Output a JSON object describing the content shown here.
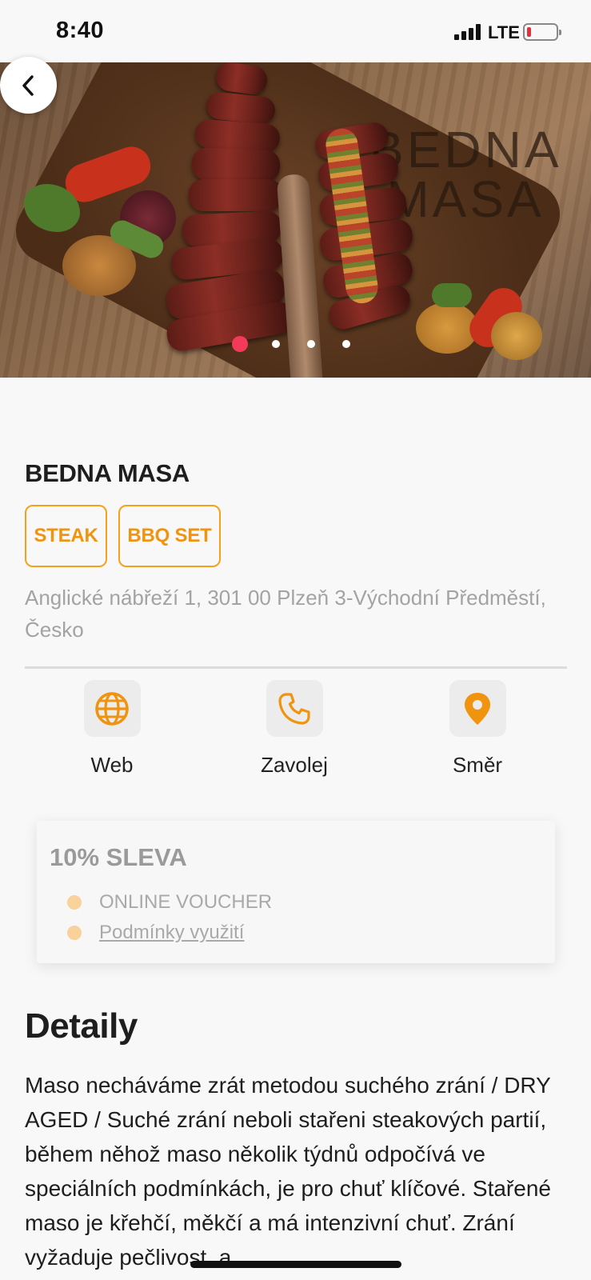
{
  "status_bar": {
    "time": "8:40",
    "network": "LTE",
    "battery_level": 0.1,
    "battery_color": "#e0333f"
  },
  "hero": {
    "logo_line1": "BEDNA",
    "logo_line2": "MASA",
    "image_count": 4,
    "active_image": 1,
    "active_dot_color": "#f33a5a"
  },
  "restaurant": {
    "name": "BEDNA MASA",
    "tags": [
      "STEAK",
      "BBQ SET"
    ],
    "address": "Anglické nábřeží 1, 301 00 Plzeň 3-Východní Předměstí, Česko"
  },
  "actions": {
    "web_label": "Web",
    "call_label": "Zavolej",
    "direction_label": "Směr"
  },
  "offer": {
    "title": "10% SLEVA",
    "item1": "ONLINE VOUCHER",
    "item2": "Podmínky využití"
  },
  "details": {
    "heading": "Detaily",
    "text": "Maso necháváme zrát metodou suchého zrání / DRY AGED / Suché zrání neboli stařeni steakových partií, během něhož maso několik týdnů odpočívá ve speciálních podmínkách, je pro chuť klíčové. Stařené maso je křehčí, měkčí a má intenzivní chuť. Zrání vyžaduje pečlivost, a"
  },
  "colors": {
    "accent": "#f4a11b",
    "tag_text": "#f0930e"
  },
  "icons": [
    "back-icon",
    "globe-icon",
    "phone-icon",
    "location-pin-icon"
  ]
}
